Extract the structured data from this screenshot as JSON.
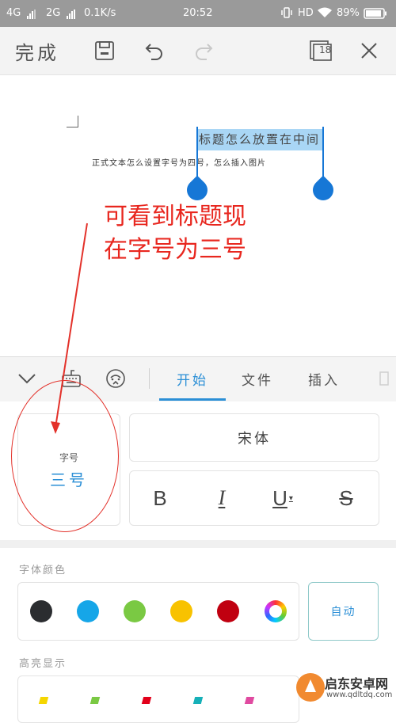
{
  "status_bar": {
    "network1": "4G",
    "network2": "2G",
    "speed": "0.1K/s",
    "time": "20:52",
    "hd": "HD",
    "battery": "89%"
  },
  "toolbar": {
    "done_label": "完成",
    "page_count": "18"
  },
  "document": {
    "title_text": "标题怎么放置在中间",
    "body_text": "正式文本怎么设置字号为四号，怎么插入图片"
  },
  "annotation": {
    "line1": "可看到标题现",
    "line2": "在字号为三号"
  },
  "tabs": {
    "start": "开始",
    "file": "文件",
    "insert": "插入"
  },
  "format": {
    "font_size_label": "字号",
    "font_size_value": "三号",
    "font_name": "宋体",
    "bold_label": "B",
    "italic_label": "I",
    "underline_label": "U",
    "strike_label": "S"
  },
  "font_color": {
    "section_label": "字体颜色",
    "swatches": [
      "#2b2d30",
      "#16a6e8",
      "#7ac943",
      "#f8c200",
      "#c00010"
    ],
    "auto_label": "自动"
  },
  "highlight": {
    "section_label": "高亮显示",
    "marks": [
      "#f5d600",
      "#7ac943",
      "#e2001a",
      "#16b0b8",
      "#e04aa0"
    ]
  },
  "watermark": {
    "name": "启东安卓网",
    "url": "www.qdltdq.com"
  },
  "colors": {
    "accent": "#2b8fd6",
    "annotation": "#e8271f",
    "selection": "#a9d6f5",
    "handle": "#1677d6"
  }
}
